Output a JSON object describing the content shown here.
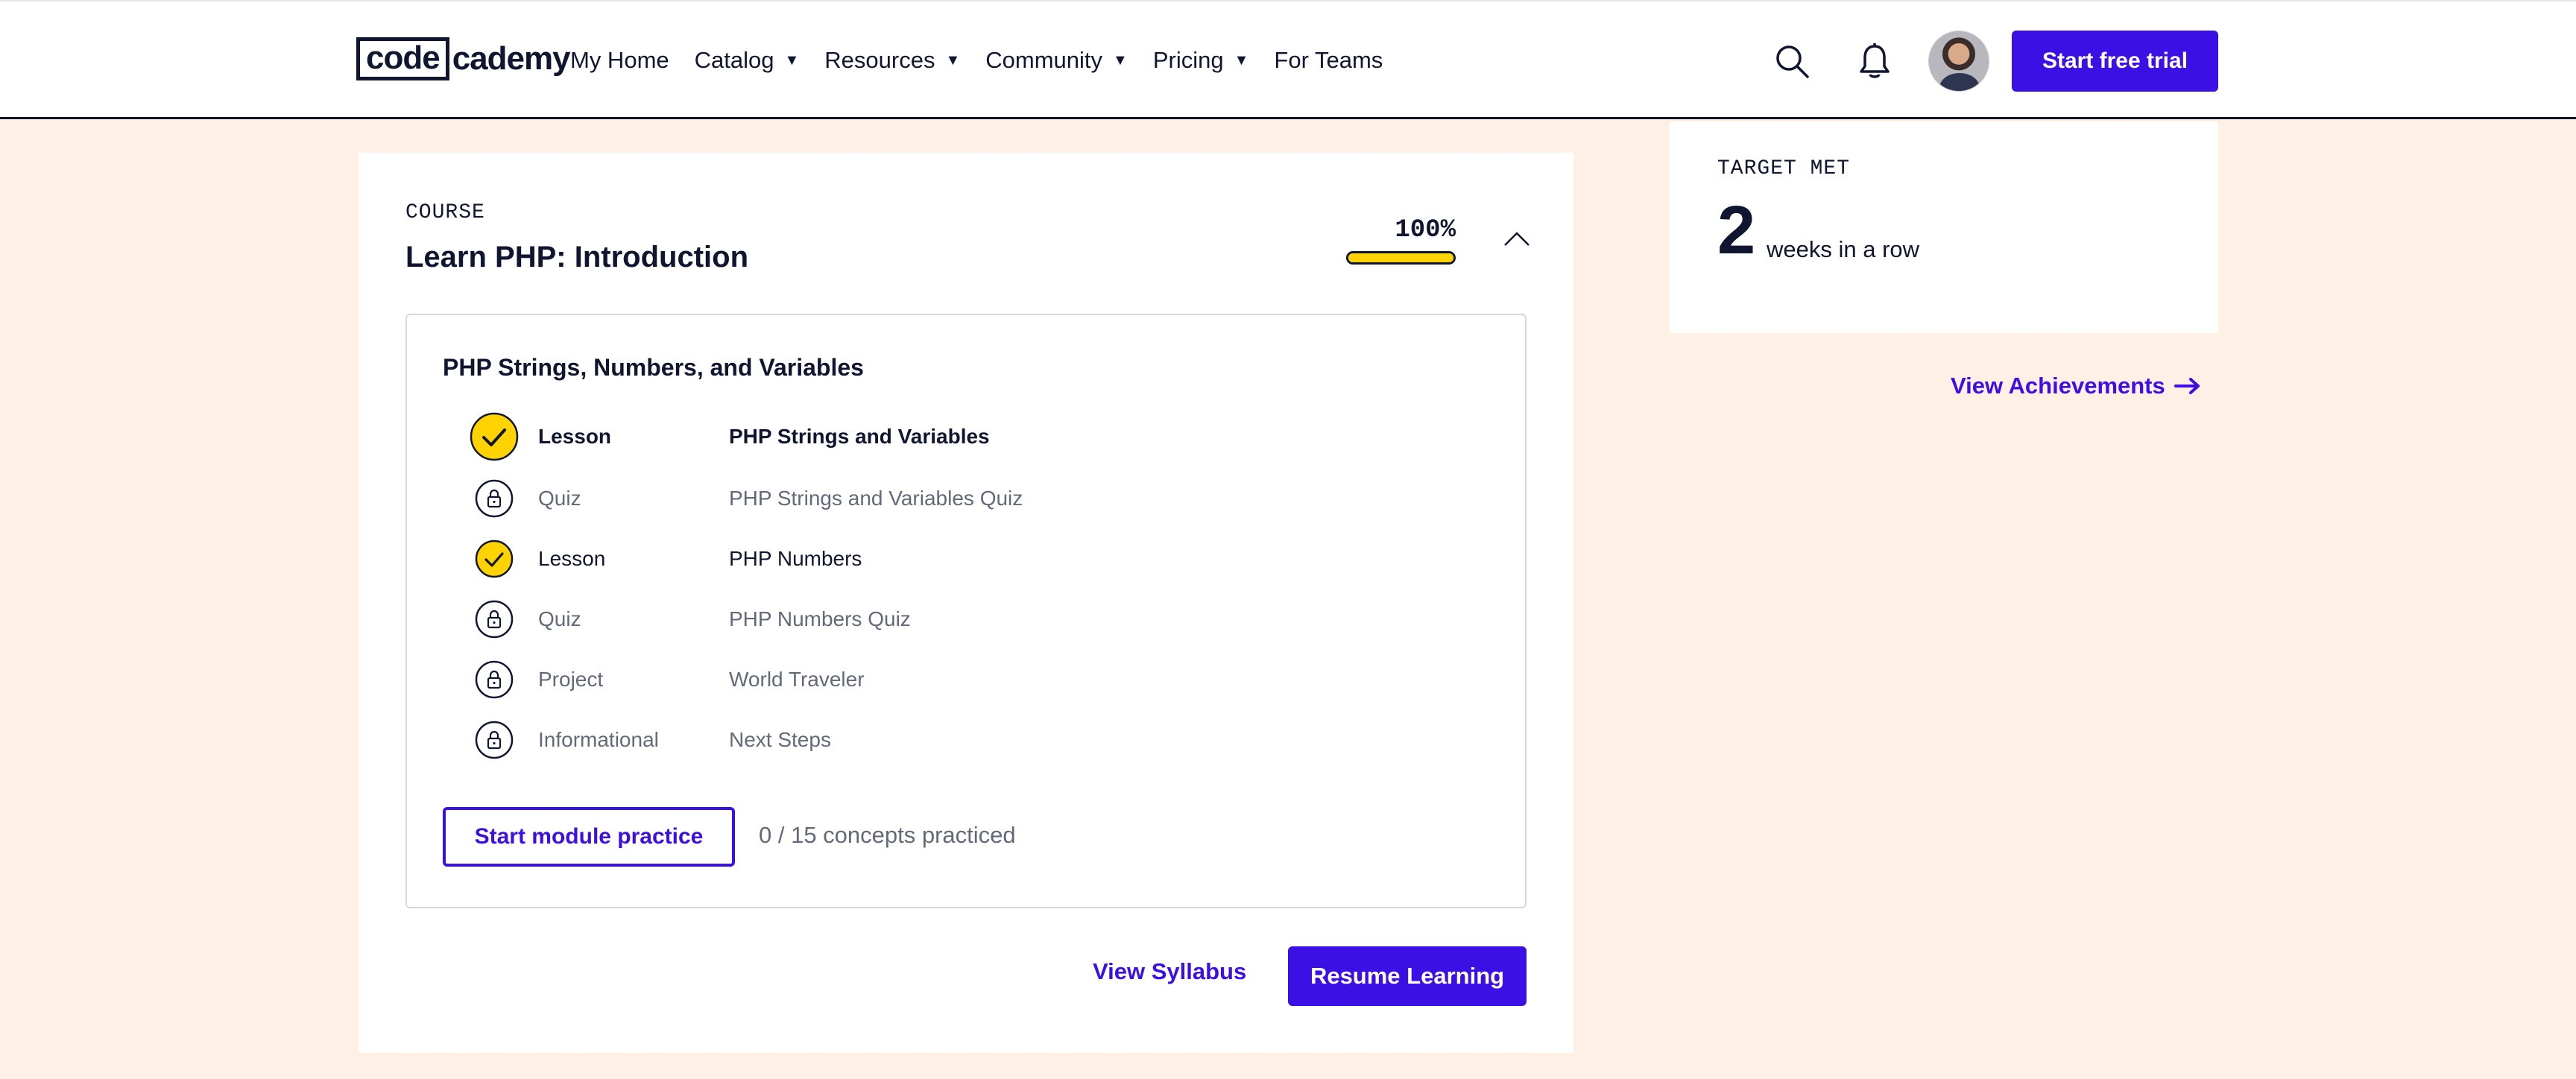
{
  "header": {
    "logo_code": "code",
    "logo_rest": "cademy",
    "nav": [
      {
        "label": "My Home",
        "dropdown": false
      },
      {
        "label": "Catalog",
        "dropdown": true
      },
      {
        "label": "Resources",
        "dropdown": true
      },
      {
        "label": "Community",
        "dropdown": true
      },
      {
        "label": "Pricing",
        "dropdown": true
      },
      {
        "label": "For Teams",
        "dropdown": false
      }
    ],
    "cta_label": "Start free trial"
  },
  "course": {
    "eyebrow": "COURSE",
    "title": "Learn PHP: Introduction",
    "progress_label": "100%",
    "progress_fraction": 1.0,
    "module": {
      "title": "PHP Strings, Numbers, and Variables",
      "items": [
        {
          "type": "Lesson",
          "name": "PHP Strings and Variables",
          "status": "complete",
          "current": true
        },
        {
          "type": "Quiz",
          "name": "PHP Strings and Variables Quiz",
          "status": "locked",
          "current": false
        },
        {
          "type": "Lesson",
          "name": "PHP Numbers",
          "status": "complete",
          "current": false
        },
        {
          "type": "Quiz",
          "name": "PHP Numbers Quiz",
          "status": "locked",
          "current": false
        },
        {
          "type": "Project",
          "name": "World Traveler",
          "status": "locked",
          "current": false
        },
        {
          "type": "Informational",
          "name": "Next Steps",
          "status": "locked",
          "current": false
        }
      ],
      "practice_button": "Start module practice",
      "practice_count": "0 / 15 concepts practiced"
    },
    "syllabus_link": "View Syllabus",
    "resume_button": "Resume Learning"
  },
  "streak": {
    "eyebrow": "TARGET MET",
    "count": "2",
    "label": "weeks in a row",
    "achievements_link": "View Achievements"
  },
  "colors": {
    "accent": "#3a10e5",
    "navy": "#10162f",
    "yellow": "#ffd300",
    "background": "#fff0e5"
  },
  "icons": {
    "search": "search-icon",
    "bell": "bell-icon",
    "complete": "check-circle-icon",
    "locked": "lock-icon",
    "collapse": "chevron-up-icon",
    "arrow": "arrow-right-icon"
  }
}
